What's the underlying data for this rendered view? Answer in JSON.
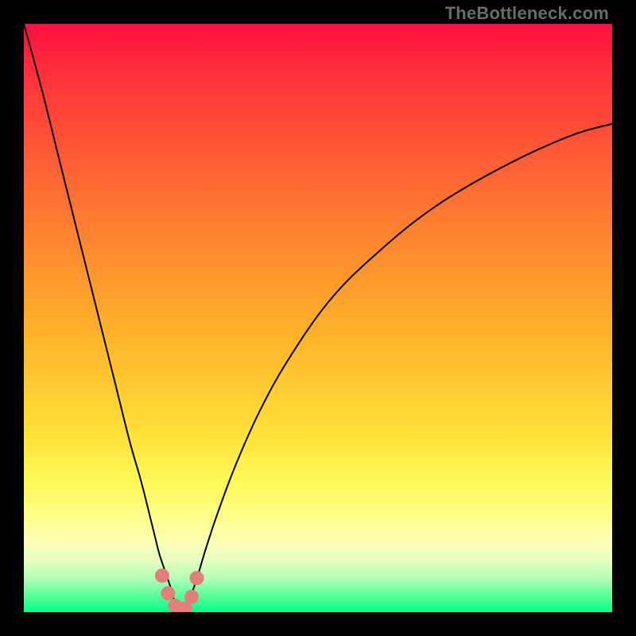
{
  "watermark": "TheBottleneck.com",
  "colors": {
    "frame": "#000000",
    "curve": "#000000",
    "marker": "#e37f7a",
    "gradient_top": "#ff0f3f",
    "gradient_bottom": "#00ff88"
  },
  "chart_data": {
    "type": "line",
    "title": "",
    "xlabel": "",
    "ylabel": "",
    "xlim": [
      0,
      100
    ],
    "ylim": [
      0,
      100
    ],
    "grid": false,
    "legend": false,
    "notes": "Two bottleneck curves (left and right) converging to ~0 near x≈26; values read from vertical position (0 at bottom, 100 at top). Pink markers cluster at the minimum.",
    "series": [
      {
        "name": "left-curve",
        "x": [
          0,
          3,
          6,
          9,
          12,
          15,
          18,
          20,
          22,
          23,
          24,
          25,
          25.7,
          26.3
        ],
        "values": [
          100,
          89,
          77,
          65,
          53,
          41,
          29,
          22,
          14,
          10,
          7,
          4,
          1.5,
          0.5
        ]
      },
      {
        "name": "right-curve",
        "x": [
          27.5,
          28.3,
          29.5,
          31,
          33,
          36,
          40,
          45,
          52,
          60,
          70,
          82,
          93,
          100
        ],
        "values": [
          0.5,
          2.5,
          6,
          11,
          17,
          25,
          34,
          43,
          53,
          61,
          69,
          76,
          81,
          83
        ]
      }
    ],
    "markers": {
      "name": "optimal-cluster",
      "x": [
        23.5,
        24.5,
        25.7,
        26.5,
        27.4,
        28.5,
        29.4
      ],
      "values": [
        6.2,
        3.2,
        1.1,
        0.6,
        0.6,
        2.6,
        5.8
      ]
    }
  }
}
